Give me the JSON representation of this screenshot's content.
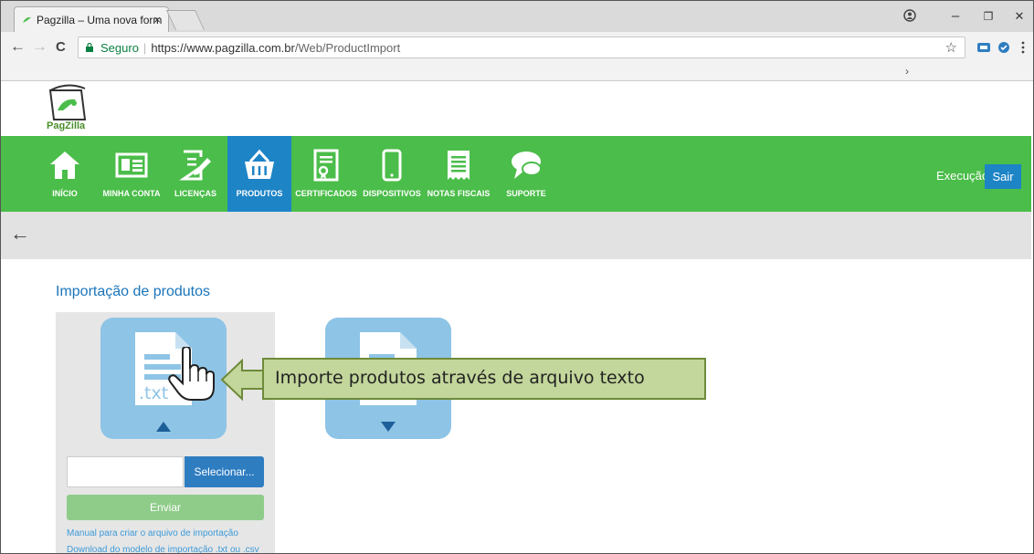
{
  "browser": {
    "tab_title": "Pagzilla – Uma nova form",
    "tab_close": "×",
    "secure_label": "Seguro",
    "url_host": "https://www.pagzilla.com.br",
    "url_path": "/Web/ProductImport",
    "bookmarks_chevron": "›",
    "win_min": "–",
    "win_restore": "❐",
    "win_close": "✕",
    "back": "←",
    "forward": "→",
    "reload": "C",
    "star": "☆"
  },
  "site": {
    "logo_text": "PagZilla",
    "nav": [
      {
        "label": "INÍCIO",
        "icon": "home-icon"
      },
      {
        "label": "MINHA CONTA",
        "icon": "id-card-icon"
      },
      {
        "label": "LICENÇAS",
        "icon": "edit-document-icon"
      },
      {
        "label": "PRODUTOS",
        "icon": "basket-icon",
        "active": true
      },
      {
        "label": "CERTIFICADOS",
        "icon": "certificate-icon"
      },
      {
        "label": "DISPOSITIVOS",
        "icon": "mobile-icon"
      },
      {
        "label": "NOTAS FISCAIS",
        "icon": "receipt-icon"
      },
      {
        "label": "SUPORTE",
        "icon": "chat-icon"
      }
    ],
    "env_label": "Execução",
    "logout_label": "Sair",
    "back_arrow": "←"
  },
  "main": {
    "title": "Importação de produtos",
    "import_tile_label": ".txt",
    "select_button": "Selecionar...",
    "file_value": "",
    "send_button": "Enviar",
    "links": [
      "Manual para criar o arquivo de importação",
      "Download do modelo de importação .txt ou .csv"
    ]
  },
  "callout": {
    "text": "Importe produtos através de arquivo texto"
  },
  "colors": {
    "nav_green": "#4bbd4a",
    "active_blue": "#1d84c6",
    "tile_blue": "#8ec4e6",
    "callout_fill": "#c3d69b"
  }
}
